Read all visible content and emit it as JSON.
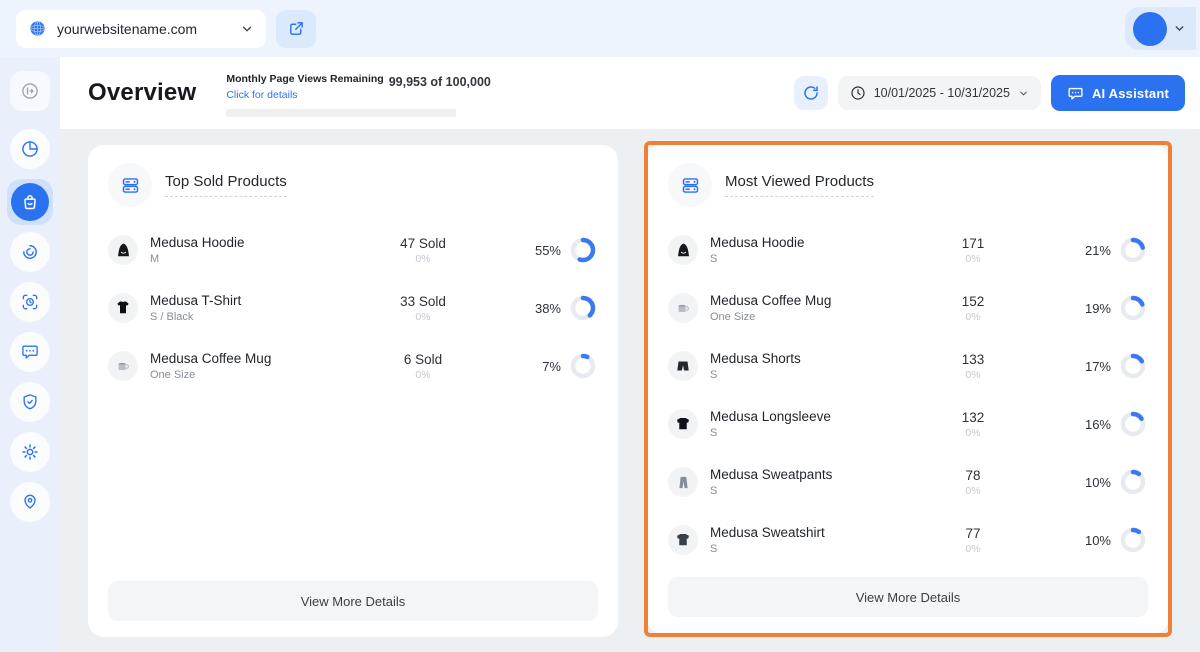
{
  "topbar": {
    "site_selector": {
      "domain": "yourwebsitename.com",
      "icon": "globe-icon",
      "chevron": "chevron-down-icon"
    },
    "external_link_icon": "external-link-icon",
    "avatar": {
      "icon": "avatar-circle",
      "chevron": "chevron-down-icon"
    }
  },
  "sidebar": {
    "items": [
      {
        "icon": "panel-toggle-icon",
        "active": false,
        "toggle": true
      },
      {
        "icon": "pie-chart-icon",
        "active": false
      },
      {
        "icon": "shopping-bag-icon",
        "active": true
      },
      {
        "icon": "gauge-icon",
        "active": false
      },
      {
        "icon": "monitor-clock-icon",
        "active": false
      },
      {
        "icon": "chat-dots-icon",
        "active": false
      },
      {
        "icon": "shield-check-icon",
        "active": false
      },
      {
        "icon": "gear-icon",
        "active": false
      },
      {
        "icon": "map-pin-icon",
        "active": false
      }
    ]
  },
  "header": {
    "title": "Overview",
    "page_views": {
      "label": "Monthly Page Views Remaining",
      "link": "Click for details",
      "usage": "99,953 of 100,000"
    },
    "refresh_icon": "refresh-icon",
    "date_range": "10/01/2025 - 10/31/2025",
    "ai_assistant": {
      "label": "AI Assistant",
      "icon": "chat-bubble-icon"
    }
  },
  "cards": [
    {
      "title": "Top Sold Products",
      "header_icon": "server-icon",
      "footer": "View More Details",
      "highlighted": false,
      "rows": [
        {
          "icon": "hoodie-icon",
          "name": "Medusa Hoodie",
          "variant": "M",
          "value": "47 Sold",
          "sub": "0%",
          "percent_label": "55%",
          "percent": 55
        },
        {
          "icon": "tshirt-icon",
          "name": "Medusa T-Shirt",
          "variant": "S / Black",
          "value": "33 Sold",
          "sub": "0%",
          "percent_label": "38%",
          "percent": 38
        },
        {
          "icon": "mug-icon",
          "name": "Medusa Coffee Mug",
          "variant": "One Size",
          "value": "6 Sold",
          "sub": "0%",
          "percent_label": "7%",
          "percent": 7
        }
      ]
    },
    {
      "title": "Most Viewed Products",
      "header_icon": "server-icon",
      "footer": "View More Details",
      "highlighted": true,
      "rows": [
        {
          "icon": "hoodie-icon",
          "name": "Medusa Hoodie",
          "variant": "S",
          "value": "171",
          "sub": "0%",
          "percent_label": "21%",
          "percent": 21
        },
        {
          "icon": "mug-icon",
          "name": "Medusa Coffee Mug",
          "variant": "One Size",
          "value": "152",
          "sub": "0%",
          "percent_label": "19%",
          "percent": 19
        },
        {
          "icon": "shorts-icon",
          "name": "Medusa Shorts",
          "variant": "S",
          "value": "133",
          "sub": "0%",
          "percent_label": "17%",
          "percent": 17
        },
        {
          "icon": "longsleeve-icon",
          "name": "Medusa Longsleeve",
          "variant": "S",
          "value": "132",
          "sub": "0%",
          "percent_label": "16%",
          "percent": 16
        },
        {
          "icon": "sweatpants-icon",
          "name": "Medusa Sweatpants",
          "variant": "S",
          "value": "78",
          "sub": "0%",
          "percent_label": "10%",
          "percent": 10
        },
        {
          "icon": "sweatshirt-icon",
          "name": "Medusa Sweatshirt",
          "variant": "S",
          "value": "77",
          "sub": "0%",
          "percent_label": "10%",
          "percent": 10
        }
      ]
    }
  ],
  "colors": {
    "accent_blue": "#2b72f0",
    "donut_blue": "#3b79f2",
    "donut_track": "#e7eaee",
    "highlight_border": "#f08038",
    "topbar_bg": "#eef4fd",
    "sidebar_bg": "#e9f0fc",
    "page_bg": "#edf0f3"
  }
}
